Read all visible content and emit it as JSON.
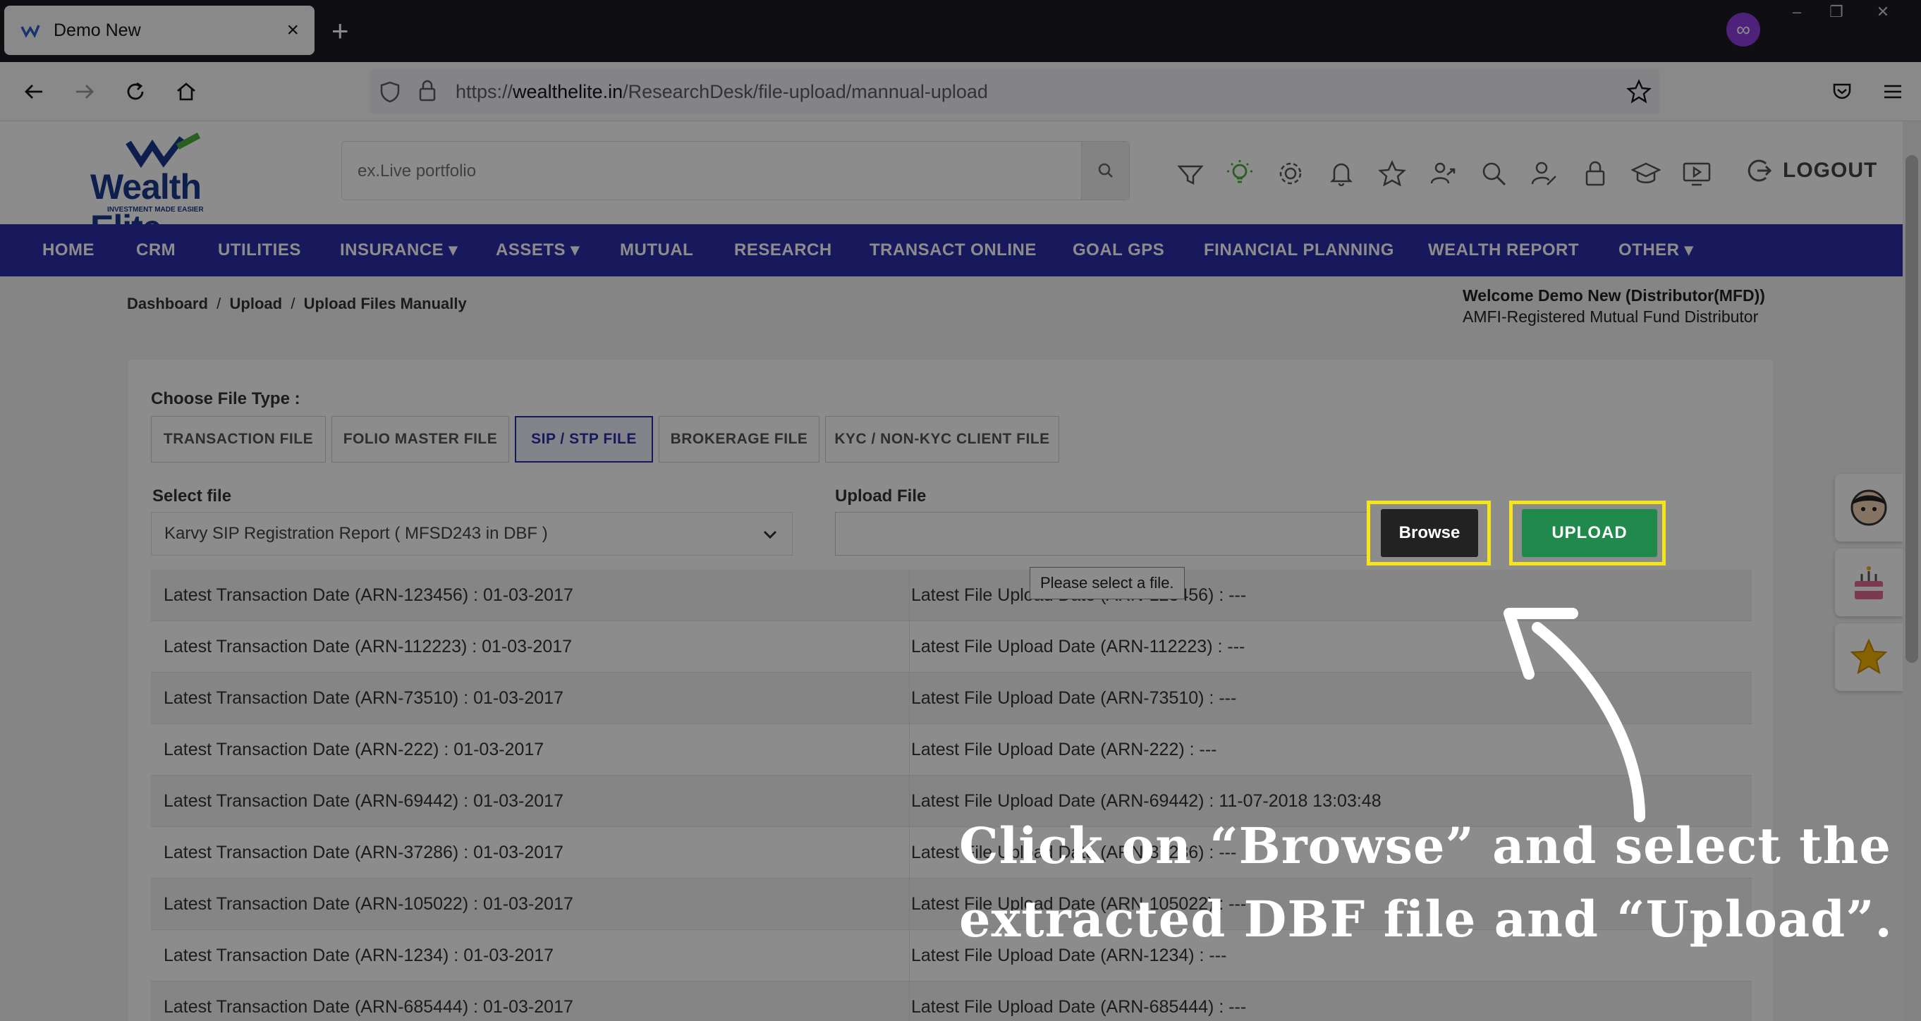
{
  "browser": {
    "tab_title": "Demo New",
    "url_prefix": "https://",
    "url_domain": "wealthelite.in",
    "url_path": "/ResearchDesk/file-upload/mannual-upload"
  },
  "header": {
    "logo_text": "Wealth Elite",
    "logo_tagline": "INVESTMENT MADE EASIER",
    "search_placeholder": "ex.Live portfolio",
    "logout_label": "LOGOUT"
  },
  "nav": {
    "items": [
      "HOME",
      "CRM",
      "UTILITIES",
      "INSURANCE ▾",
      "ASSETS ▾",
      "MUTUAL",
      "RESEARCH",
      "TRANSACT ONLINE",
      "GOAL GPS",
      "FINANCIAL PLANNING",
      "WEALTH REPORT",
      "OTHER ▾"
    ]
  },
  "breadcrumb": {
    "dashboard": "Dashboard",
    "sep": "/",
    "upload": "Upload",
    "current": "Upload Files Manually"
  },
  "welcome": {
    "line1": "Welcome Demo New (Distributor(MFD))",
    "line2": "AMFI-Registered Mutual Fund Distributor"
  },
  "form": {
    "choose_label": "Choose File Type :",
    "file_types": [
      "TRANSACTION FILE",
      "FOLIO MASTER FILE",
      "SIP / STP FILE",
      "BROKERAGE FILE",
      "KYC / NON-KYC CLIENT FILE"
    ],
    "active_type": "SIP / STP FILE",
    "select_label": "Select file",
    "select_value": "Karvy SIP Registration Report ( MFSD243 in DBF )",
    "upload_label": "Upload File",
    "browse_label": "Browse",
    "upload_button": "UPLOAD",
    "tooltip": "Please select a file."
  },
  "rows": [
    {
      "left": "Latest Transaction Date (ARN-123456) : 01-03-2017",
      "right": "Latest File Upload Date (ARN-123456) : ---"
    },
    {
      "left": "Latest Transaction Date (ARN-112223) : 01-03-2017",
      "right": "Latest File Upload Date (ARN-112223) : ---"
    },
    {
      "left": "Latest Transaction Date (ARN-73510) : 01-03-2017",
      "right": "Latest File Upload Date (ARN-73510) : ---"
    },
    {
      "left": "Latest Transaction Date (ARN-222) : 01-03-2017",
      "right": "Latest File Upload Date (ARN-222) : ---"
    },
    {
      "left": "Latest Transaction Date (ARN-69442) : 01-03-2017",
      "right": "Latest File Upload Date (ARN-69442) : 11-07-2018 13:03:48"
    },
    {
      "left": "Latest Transaction Date (ARN-37286) : 01-03-2017",
      "right": "Latest File Upload Date (ARN-37286) : ---"
    },
    {
      "left": "Latest Transaction Date (ARN-105022) : 01-03-2017",
      "right": "Latest File Upload Date (ARN-105022) : ---"
    },
    {
      "left": "Latest Transaction Date (ARN-1234) : 01-03-2017",
      "right": "Latest File Upload Date (ARN-1234) : ---"
    },
    {
      "left": "Latest Transaction Date (ARN-685444) : 01-03-2017",
      "right": "Latest File Upload Date (ARN-685444) : ---"
    }
  ],
  "annotation": {
    "line1": "Click on “Browse” and select the",
    "line2": "extracted DBF file and “Upload”."
  },
  "colors": {
    "nav_bg": "#2b2fa8",
    "highlight": "#f5e51a",
    "upload_green": "#1f8a4c"
  }
}
